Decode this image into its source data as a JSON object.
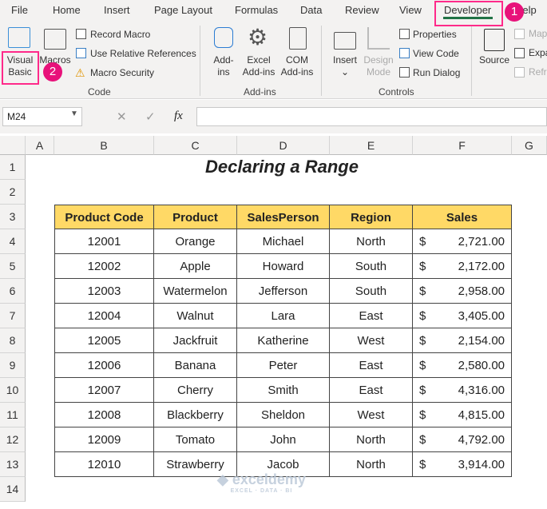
{
  "menu": {
    "tabs": [
      "File",
      "Home",
      "Insert",
      "Page Layout",
      "Formulas",
      "Data",
      "Review",
      "View",
      "Developer",
      "Help"
    ],
    "active": "Developer"
  },
  "ribbon": {
    "code": {
      "visual_basic": "Visual Basic",
      "macros": "Macros",
      "record_macro": "Record Macro",
      "relative_refs": "Use Relative References",
      "macro_security": "Macro Security",
      "group": "Code"
    },
    "addins": {
      "addins": "Add-ins",
      "excel_addins": "Excel Add-ins",
      "com_addins": "COM Add-ins",
      "group": "Add-ins"
    },
    "controls": {
      "insert": "Insert",
      "design_mode": "Design Mode",
      "properties": "Properties",
      "view_code": "View Code",
      "run_dialog": "Run Dialog",
      "group": "Controls"
    },
    "xml": {
      "source": "Source",
      "map": "Map",
      "expand": "Expa",
      "refresh": "Refr"
    }
  },
  "annotations": {
    "badge1": "1",
    "badge2": "2"
  },
  "formula_bar": {
    "name_box": "M24",
    "fx": "fx",
    "value": ""
  },
  "columns": [
    "A",
    "B",
    "C",
    "D",
    "E",
    "F",
    "G"
  ],
  "rows": [
    "1",
    "2",
    "3",
    "4",
    "5",
    "6",
    "7",
    "8",
    "9",
    "10",
    "11",
    "12",
    "13",
    "14"
  ],
  "sheet": {
    "title": "Declaring a Range",
    "headers": [
      "Product Code",
      "Product",
      "SalesPerson",
      "Region",
      "Sales"
    ],
    "currency": "$",
    "data": [
      [
        "12001",
        "Orange",
        "Michael",
        "North",
        "2,721.00"
      ],
      [
        "12002",
        "Apple",
        "Howard",
        "South",
        "2,172.00"
      ],
      [
        "12003",
        "Watermelon",
        "Jefferson",
        "South",
        "2,958.00"
      ],
      [
        "12004",
        "Walnut",
        "Lara",
        "East",
        "3,405.00"
      ],
      [
        "12005",
        "Jackfruit",
        "Katherine",
        "West",
        "2,154.00"
      ],
      [
        "12006",
        "Banana",
        "Peter",
        "East",
        "2,580.00"
      ],
      [
        "12007",
        "Cherry",
        "Smith",
        "East",
        "4,316.00"
      ],
      [
        "12008",
        "Blackberry",
        "Sheldon",
        "West",
        "4,815.00"
      ],
      [
        "12009",
        "Tomato",
        "John",
        "North",
        "4,792.00"
      ],
      [
        "12010",
        "Strawberry",
        "Jacob",
        "North",
        "3,914.00"
      ]
    ]
  },
  "watermark": {
    "brand": "exceldemy",
    "tagline": "EXCEL · DATA · BI"
  },
  "colors": {
    "highlight": "#ff2a8a",
    "header_fill": "#ffd966",
    "developer_underline": "#217346"
  }
}
